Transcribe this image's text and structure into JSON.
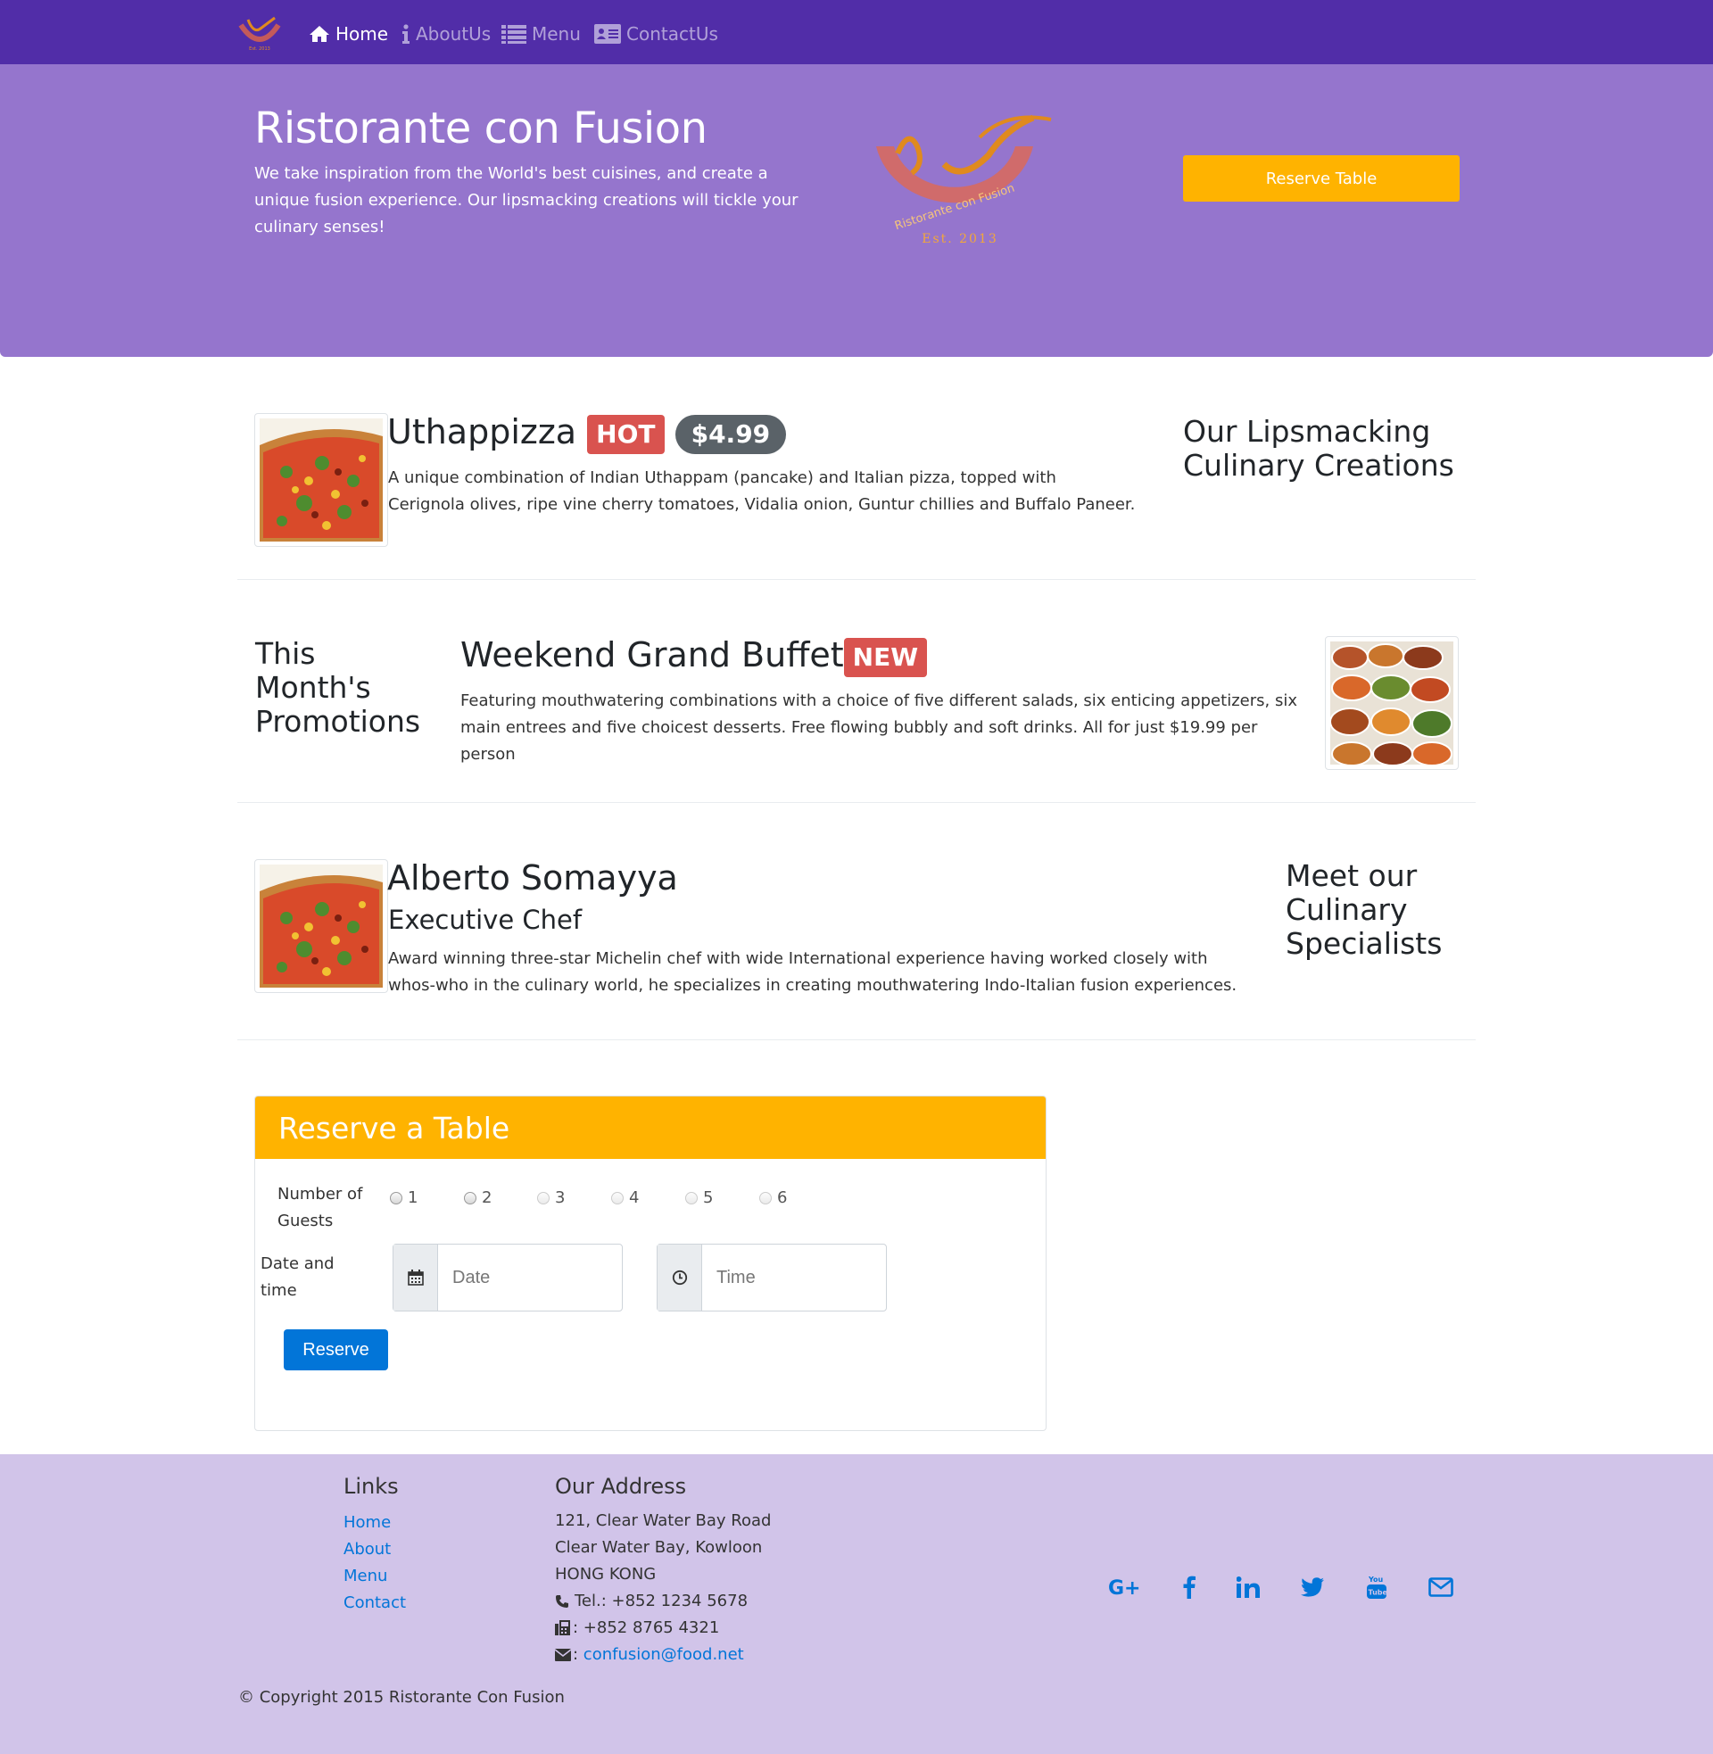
{
  "nav": {
    "items": [
      {
        "label": "Home",
        "icon": "home-icon",
        "active": true
      },
      {
        "label": "AboutUs",
        "icon": "info-icon",
        "active": false
      },
      {
        "label": "Menu",
        "icon": "list-icon",
        "active": false
      },
      {
        "label": "ContactUs",
        "icon": "address-card-icon",
        "active": false
      }
    ]
  },
  "jumbotron": {
    "title": "Ristorante con Fusion",
    "description": "We take inspiration from the World's best cuisines, and create a unique fusion experience. Our lipsmacking creations will tickle your culinary senses!",
    "logo_text": "Ristorante con Fusion",
    "logo_est": "Est. 2013",
    "reserve_button": "Reserve Table"
  },
  "dish": {
    "name": "Uthappizza",
    "badge": "HOT",
    "price": "$4.99",
    "description": "A unique combination of Indian Uthappam (pancake) and Italian pizza, topped with Cerignola olives, ripe vine cherry tomatoes, Vidalia onion, Guntur chillies and Buffalo Paneer.",
    "side_heading": "Our Lipsmacking Culinary Creations"
  },
  "promotion": {
    "side_heading": "This Month's Promotions",
    "name": "Weekend Grand Buffet",
    "badge": "NEW",
    "description": "Featuring mouthwatering combinations with a choice of five different salads, six enticing appetizers, six main entrees and five choicest desserts. Free flowing bubbly and soft drinks. All for just $19.99 per person"
  },
  "leader": {
    "name": "Alberto Somayya",
    "designation": "Executive Chef",
    "description": "Award winning three-star Michelin chef with wide International experience having worked closely with whos-who in the culinary world, he specializes in creating mouthwatering Indo-Italian fusion experiences.",
    "side_heading": "Meet our Culinary Specialists"
  },
  "reserve": {
    "title": "Reserve a Table",
    "guests_label": "Number of Guests",
    "guest_options": [
      "1",
      "2",
      "3",
      "4",
      "5",
      "6"
    ],
    "datetime_label": "Date and time",
    "date_placeholder": "Date",
    "time_placeholder": "Time",
    "submit_label": "Reserve"
  },
  "footer": {
    "links_heading": "Links",
    "links": [
      "Home",
      "About",
      "Menu",
      "Contact"
    ],
    "address_heading": "Our Address",
    "address_lines": [
      "121, Clear Water Bay Road",
      "Clear Water Bay, Kowloon",
      "HONG KONG"
    ],
    "tel": "Tel.: +852 1234 5678",
    "fax": ": +852 8765 4321",
    "email_prefix": ": ",
    "email": "confusion@food.net",
    "social": [
      "google-plus-icon",
      "facebook-icon",
      "linkedin-icon",
      "twitter-icon",
      "youtube-icon",
      "envelope-icon"
    ],
    "copyright": "© Copyright 2015 Ristorante Con Fusion"
  },
  "colors": {
    "navbar": "#512da8",
    "jumbotron": "#9575cd",
    "accent": "#ffb300",
    "footer": "#d1c4e9",
    "primary": "#0275d8",
    "danger": "#d9534f"
  }
}
